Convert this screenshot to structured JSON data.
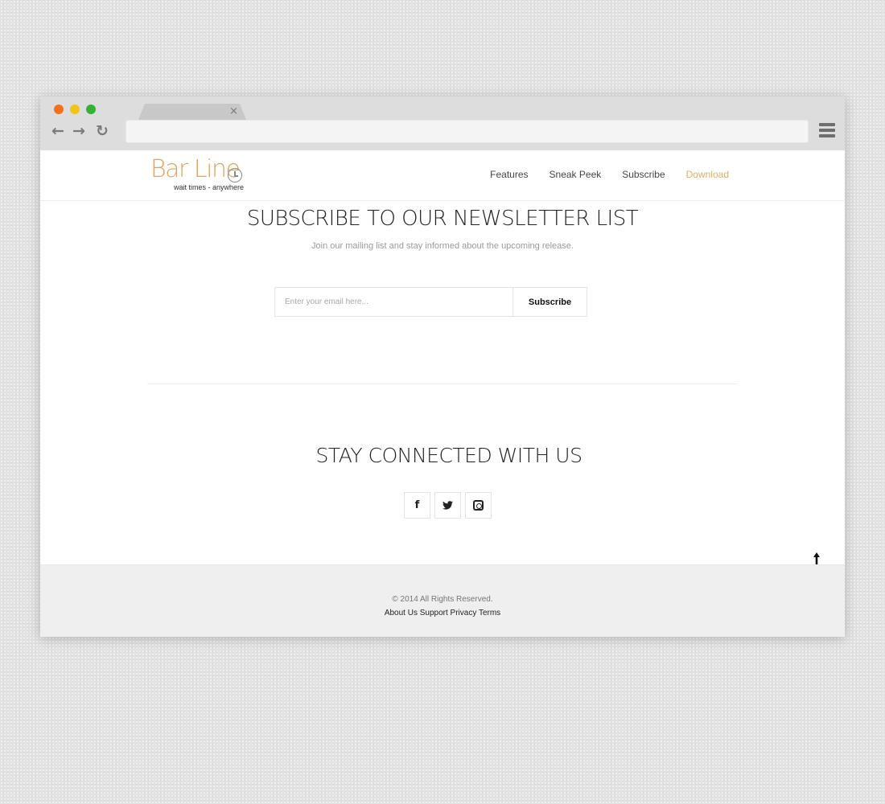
{
  "browser": {
    "tab_close": "×",
    "back_icon": "←",
    "forward_icon": "→",
    "reload_icon": "↻",
    "url": ""
  },
  "header": {
    "logo_title": "Bar Line",
    "logo_tagline": "wait times - anywhere",
    "nav": [
      {
        "label": "Features"
      },
      {
        "label": "Sneak Peek"
      },
      {
        "label": "Subscribe"
      },
      {
        "label": "Download"
      }
    ]
  },
  "newsletter": {
    "title": "SUBSCRIBE TO OUR NEWSLETTER LIST",
    "subtitle": "Join our mailing list and stay informed about the upcoming release.",
    "email_placeholder": "Enter your email here...",
    "button_label": "Subscribe"
  },
  "connected": {
    "title": "STAY CONNECTED WITH US",
    "socials": [
      {
        "icon": "facebook-icon",
        "glyph": "f"
      },
      {
        "icon": "twitter-icon",
        "glyph": "🐦"
      },
      {
        "icon": "instagram-icon",
        "glyph": ""
      }
    ]
  },
  "back_to_top_icon": "🠕",
  "footer": {
    "copyright": "© 2014 All Rights Reserved.",
    "links": [
      "About Us",
      "Support",
      "Privacy",
      "Terms"
    ]
  },
  "colors": {
    "accent": "#d7a762",
    "dot_red": "#f2711c",
    "dot_yellow": "#f0c419",
    "dot_green": "#34b233"
  }
}
